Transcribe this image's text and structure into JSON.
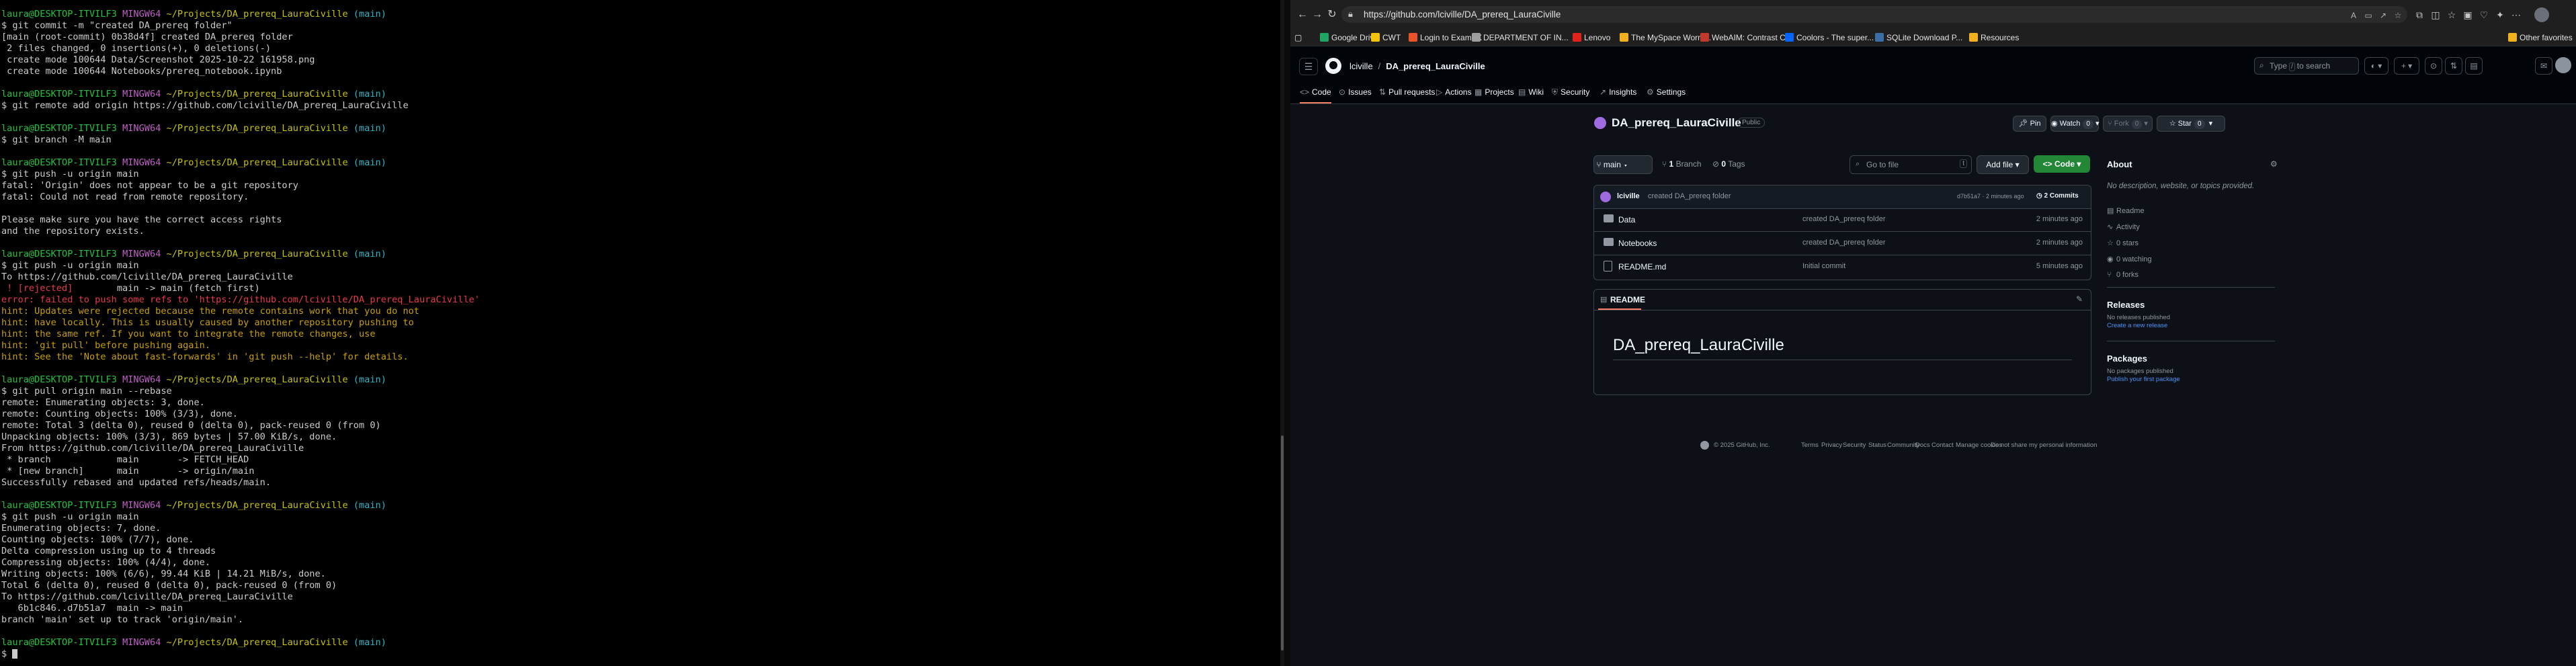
{
  "terminal": {
    "lines": [
      [
        {
          "t": "laura@DESKTOP-ITVILF3 ",
          "c": "c-green"
        },
        {
          "t": "MINGW64 ",
          "c": "c-purple"
        },
        {
          "t": "~/Projects/DA_prereq_LauraCiville ",
          "c": "c-yellow"
        },
        {
          "t": "(main)",
          "c": "c-cyan"
        }
      ],
      [
        {
          "t": "$ git commit -m \"created DA_prereq folder\""
        }
      ],
      [
        {
          "t": "[main (root-commit) 0b38d4f] created DA_prereq folder"
        }
      ],
      [
        {
          "t": " 2 files changed, 0 insertions(+), 0 deletions(-)"
        }
      ],
      [
        {
          "t": " create mode 100644 Data/Screenshot 2025-10-22 161958.png"
        }
      ],
      [
        {
          "t": " create mode 100644 Notebooks/prereq_notebook.ipynb"
        }
      ],
      [
        {
          "t": ""
        }
      ],
      [
        {
          "t": "laura@DESKTOP-ITVILF3 ",
          "c": "c-green"
        },
        {
          "t": "MINGW64 ",
          "c": "c-purple"
        },
        {
          "t": "~/Projects/DA_prereq_LauraCiville ",
          "c": "c-yellow"
        },
        {
          "t": "(main)",
          "c": "c-cyan"
        }
      ],
      [
        {
          "t": "$ git remote add origin https://github.com/lciville/DA_prereq_LauraCiville"
        }
      ],
      [
        {
          "t": ""
        }
      ],
      [
        {
          "t": "laura@DESKTOP-ITVILF3 ",
          "c": "c-green"
        },
        {
          "t": "MINGW64 ",
          "c": "c-purple"
        },
        {
          "t": "~/Projects/DA_prereq_LauraCiville ",
          "c": "c-yellow"
        },
        {
          "t": "(main)",
          "c": "c-cyan"
        }
      ],
      [
        {
          "t": "$ git branch -M main"
        }
      ],
      [
        {
          "t": ""
        }
      ],
      [
        {
          "t": "laura@DESKTOP-ITVILF3 ",
          "c": "c-green"
        },
        {
          "t": "MINGW64 ",
          "c": "c-purple"
        },
        {
          "t": "~/Projects/DA_prereq_LauraCiville ",
          "c": "c-yellow"
        },
        {
          "t": "(main)",
          "c": "c-cyan"
        }
      ],
      [
        {
          "t": "$ git push -u origin main"
        }
      ],
      [
        {
          "t": "fatal: 'Origin' does not appear to be a git repository"
        }
      ],
      [
        {
          "t": "fatal: Could not read from remote repository."
        }
      ],
      [
        {
          "t": ""
        }
      ],
      [
        {
          "t": "Please make sure you have the correct access rights"
        }
      ],
      [
        {
          "t": "and the repository exists."
        }
      ],
      [
        {
          "t": ""
        }
      ],
      [
        {
          "t": "laura@DESKTOP-ITVILF3 ",
          "c": "c-green"
        },
        {
          "t": "MINGW64 ",
          "c": "c-purple"
        },
        {
          "t": "~/Projects/DA_prereq_LauraCiville ",
          "c": "c-yellow"
        },
        {
          "t": "(main)",
          "c": "c-cyan"
        }
      ],
      [
        {
          "t": "$ git push -u origin main"
        }
      ],
      [
        {
          "t": "To https://github.com/lciville/DA_prereq_LauraCiville"
        }
      ],
      [
        {
          "t": " ! [rejected]        ",
          "c": "c-red"
        },
        {
          "t": "main -> main (fetch first)"
        }
      ],
      [
        {
          "t": "error: failed to push some refs to 'https://github.com/lciville/DA_prereq_LauraCiville'",
          "c": "c-red"
        }
      ],
      [
        {
          "t": "hint: Updates were rejected because the remote contains work that you do not",
          "c": "c-orange"
        }
      ],
      [
        {
          "t": "hint: have locally. This is usually caused by another repository pushing to",
          "c": "c-orange"
        }
      ],
      [
        {
          "t": "hint: the same ref. If you want to integrate the remote changes, use",
          "c": "c-orange"
        }
      ],
      [
        {
          "t": "hint: 'git pull' before pushing again.",
          "c": "c-orange"
        }
      ],
      [
        {
          "t": "hint: See the 'Note about fast-forwards' in 'git push --help' for details.",
          "c": "c-orange"
        }
      ],
      [
        {
          "t": ""
        }
      ],
      [
        {
          "t": "laura@DESKTOP-ITVILF3 ",
          "c": "c-green"
        },
        {
          "t": "MINGW64 ",
          "c": "c-purple"
        },
        {
          "t": "~/Projects/DA_prereq_LauraCiville ",
          "c": "c-yellow"
        },
        {
          "t": "(main)",
          "c": "c-cyan"
        }
      ],
      [
        {
          "t": "$ git pull origin main --rebase"
        }
      ],
      [
        {
          "t": "remote: Enumerating objects: 3, done."
        }
      ],
      [
        {
          "t": "remote: Counting objects: 100% (3/3), done."
        }
      ],
      [
        {
          "t": "remote: Total 3 (delta 0), reused 0 (delta 0), pack-reused 0 (from 0)"
        }
      ],
      [
        {
          "t": "Unpacking objects: 100% (3/3), 869 bytes | 57.00 KiB/s, done."
        }
      ],
      [
        {
          "t": "From https://github.com/lciville/DA_prereq_LauraCiville"
        }
      ],
      [
        {
          "t": " * branch            main       -> FETCH_HEAD"
        }
      ],
      [
        {
          "t": " * [new branch]      main       -> origin/main"
        }
      ],
      [
        {
          "t": "Successfully rebased and updated refs/heads/main."
        }
      ],
      [
        {
          "t": ""
        }
      ],
      [
        {
          "t": "laura@DESKTOP-ITVILF3 ",
          "c": "c-green"
        },
        {
          "t": "MINGW64 ",
          "c": "c-purple"
        },
        {
          "t": "~/Projects/DA_prereq_LauraCiville ",
          "c": "c-yellow"
        },
        {
          "t": "(main)",
          "c": "c-cyan"
        }
      ],
      [
        {
          "t": "$ git push -u origin main"
        }
      ],
      [
        {
          "t": "Enumerating objects: 7, done."
        }
      ],
      [
        {
          "t": "Counting objects: 100% (7/7), done."
        }
      ],
      [
        {
          "t": "Delta compression using up to 4 threads"
        }
      ],
      [
        {
          "t": "Compressing objects: 100% (4/4), done."
        }
      ],
      [
        {
          "t": "Writing objects: 100% (6/6), 99.44 KiB | 14.21 MiB/s, done."
        }
      ],
      [
        {
          "t": "Total 6 (delta 0), reused 0 (delta 0), pack-reused 0 (from 0)"
        }
      ],
      [
        {
          "t": "To https://github.com/lciville/DA_prereq_LauraCiville"
        }
      ],
      [
        {
          "t": "   6b1c846..d7b51a7  main -> main"
        }
      ],
      [
        {
          "t": "branch 'main' set up to track 'origin/main'."
        }
      ],
      [
        {
          "t": ""
        }
      ],
      [
        {
          "t": "laura@DESKTOP-ITVILF3 ",
          "c": "c-green"
        },
        {
          "t": "MINGW64 ",
          "c": "c-purple"
        },
        {
          "t": "~/Projects/DA_prereq_LauraCiville ",
          "c": "c-yellow"
        },
        {
          "t": "(main)",
          "c": "c-cyan"
        }
      ],
      [
        {
          "t": "$ "
        }
      ]
    ]
  },
  "browser": {
    "url": "https://github.com/lciville/DA_prereq_LauraCiville",
    "bookmarks": [
      {
        "label": "Google Drive",
        "color": "#1fa463"
      },
      {
        "label": "CWT",
        "color": "#f5c400"
      },
      {
        "label": "Login to ExamFX",
        "color": "#e8532a"
      },
      {
        "label": "DEPARTMENT OF IN...",
        "color": "#9e9e9e"
      },
      {
        "label": "Lenovo",
        "color": "#e2231a"
      },
      {
        "label": "The MySpace Worm...",
        "color": "#f2b01e"
      },
      {
        "label": "WebAIM: Contrast C...",
        "color": "#c0392b"
      },
      {
        "label": "Coolors - The super...",
        "color": "#0066ff"
      },
      {
        "label": "SQLite Download P...",
        "color": "#3a6ea5"
      },
      {
        "label": "Resources",
        "color": "#f2b01e"
      }
    ],
    "other_favorites": "Other favorites"
  },
  "github": {
    "crumb_owner": "lciville",
    "crumb_repo": "DA_prereq_LauraCiville",
    "search_prefix": "Type",
    "search_kbd": "/",
    "search_suffix": "to search",
    "tabs": [
      {
        "label": "Code",
        "icon": "<>"
      },
      {
        "label": "Issues",
        "icon": "⊙"
      },
      {
        "label": "Pull requests",
        "icon": "⇅"
      },
      {
        "label": "Actions",
        "icon": "▷"
      },
      {
        "label": "Projects",
        "icon": "▦"
      },
      {
        "label": "Wiki",
        "icon": "▤"
      },
      {
        "label": "Security",
        "icon": "⛨"
      },
      {
        "label": "Insights",
        "icon": "↗"
      },
      {
        "label": "Settings",
        "icon": "⚙"
      }
    ],
    "repo_name": "DA_prereq_LauraCiville",
    "visibility": "Public",
    "pin_label": "Pin",
    "watch_label": "Watch",
    "watch_count": "0",
    "fork_label": "Fork",
    "fork_count": "0",
    "star_label": "Star",
    "star_count": "0",
    "branch_name": "main",
    "branches_count": "1",
    "branches_label": "Branch",
    "tags_count": "0",
    "tags_label": "Tags",
    "goto_file": "Go to file",
    "goto_kbd": "t",
    "add_file": "Add file",
    "code_btn": "Code",
    "commit_user": "lciville",
    "commit_msg": "created DA_prereq folder",
    "commit_meta": "d7b51a7 · 2 minutes ago",
    "commits_count": "2 Commits",
    "files": [
      {
        "name": "Data",
        "type": "folder",
        "commit": "created DA_prereq folder",
        "time": "2 minutes ago"
      },
      {
        "name": "Notebooks",
        "type": "folder",
        "commit": "created DA_prereq folder",
        "time": "2 minutes ago"
      },
      {
        "name": "README.md",
        "type": "file",
        "commit": "Initial commit",
        "time": "5 minutes ago"
      }
    ],
    "readme_tab": "README",
    "readme_title": "DA_prereq_LauraCiville",
    "about": {
      "title": "About",
      "description": "No description, website, or topics provided.",
      "items": [
        {
          "icon": "▤",
          "label": "Readme"
        },
        {
          "icon": "∿",
          "label": "Activity"
        },
        {
          "icon": "☆",
          "label": "0 stars"
        },
        {
          "icon": "◉",
          "label": "0 watching"
        },
        {
          "icon": "⑂",
          "label": "0 forks"
        }
      ]
    },
    "releases": {
      "title": "Releases",
      "sub": "No releases published",
      "link": "Create a new release"
    },
    "packages": {
      "title": "Packages",
      "sub": "No packages published",
      "link": "Publish your first package"
    },
    "footer": [
      "© 2025 GitHub, Inc.",
      "Terms",
      "Privacy",
      "Security",
      "Status",
      "Community",
      "Docs",
      "Contact",
      "Manage cookies",
      "Do not share my personal information"
    ]
  }
}
